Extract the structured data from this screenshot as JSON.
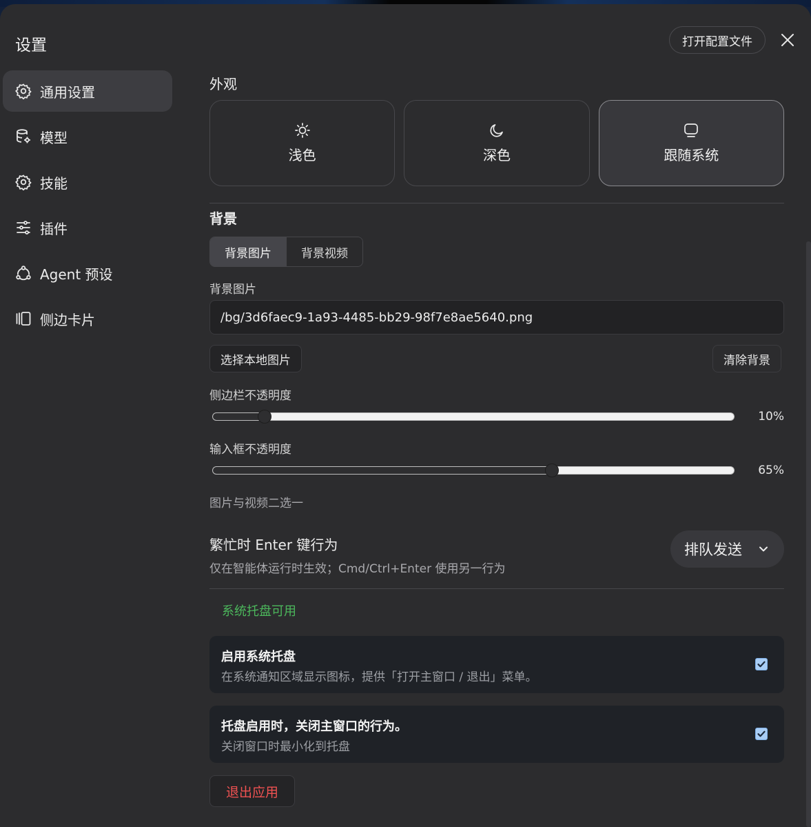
{
  "window": {
    "title": "设置",
    "open_config_label": "打开配置文件"
  },
  "sidebar": {
    "items": [
      {
        "label": "通用设置",
        "icon": "gear-icon",
        "active": true
      },
      {
        "label": "模型",
        "icon": "database-gear-icon",
        "active": false
      },
      {
        "label": "技能",
        "icon": "gear-icon",
        "active": false
      },
      {
        "label": "插件",
        "icon": "sliders-icon",
        "active": false
      },
      {
        "label": "Agent 预设",
        "icon": "agent-network-icon",
        "active": false
      },
      {
        "label": "侧边卡片",
        "icon": "side-card-icon",
        "active": false
      }
    ]
  },
  "appearance": {
    "title": "外观",
    "options": [
      {
        "label": "浅色",
        "icon": "sun-icon",
        "active": false
      },
      {
        "label": "深色",
        "icon": "moon-icon",
        "active": false
      },
      {
        "label": "跟随系统",
        "icon": "monitor-icon",
        "active": true
      }
    ]
  },
  "background": {
    "title": "背景",
    "tabs": [
      {
        "label": "背景图片",
        "active": true
      },
      {
        "label": "背景视频",
        "active": false
      }
    ],
    "image_label": "背景图片",
    "image_path": "/bg/3d6faec9-1a93-4485-bb29-98f7e8ae5640.png",
    "choose_local_label": "选择本地图片",
    "clear_label": "清除背景",
    "sidebar_opacity_label": "侧边栏不透明度",
    "sidebar_opacity_value": 10,
    "sidebar_opacity_text": "10%",
    "input_opacity_label": "输入框不透明度",
    "input_opacity_value": 65,
    "input_opacity_text": "65%",
    "hint": "图片与视频二选一"
  },
  "enter_behavior": {
    "title": "繁忙时 Enter 键行为",
    "subtitle": "仅在智能体运行时生效；Cmd/Ctrl+Enter 使用另一行为",
    "selected": "排队发送"
  },
  "tray": {
    "status": "系统托盘可用",
    "status_color": "#4cb85c",
    "enable_title": "启用系统托盘",
    "enable_subtitle": "在系统通知区域显示图标，提供「打开主窗口 / 退出」菜单。",
    "enable_checked": true,
    "close_title": "托盘启用时，关闭主窗口的行为。",
    "close_subtitle": "关闭窗口时最小化到托盘",
    "close_checked": true
  },
  "exit_label": "退出应用",
  "colors": {
    "panel_bg": "#2c2c2e",
    "danger": "#f05252",
    "checkbox": "#a8cdf5"
  }
}
